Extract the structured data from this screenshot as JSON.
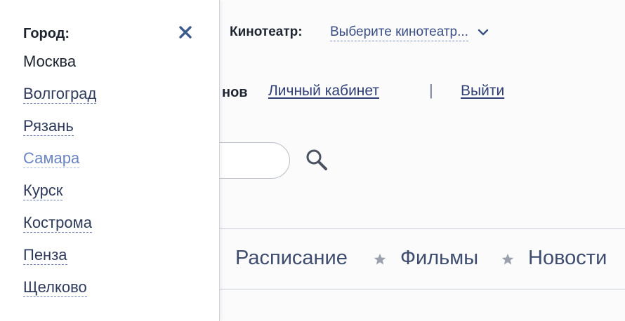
{
  "header": {
    "cinema_label": "Кинотеатр:",
    "cinema_select": "Выберите кинотеатр...",
    "user_fragment": "нов",
    "account_link": "Личный кабинет",
    "separator": "|",
    "logout_link": "Выйти"
  },
  "nav": {
    "items": [
      {
        "label": "Расписание"
      },
      {
        "label": "Фильмы"
      },
      {
        "label": "Новости"
      }
    ]
  },
  "city_panel": {
    "title": "Город:",
    "current": "Москва",
    "cities": [
      {
        "label": "Москва",
        "state": "current"
      },
      {
        "label": "Волгоград",
        "state": "link"
      },
      {
        "label": "Рязань",
        "state": "link"
      },
      {
        "label": "Самара",
        "state": "hover"
      },
      {
        "label": "Курск",
        "state": "link"
      },
      {
        "label": "Кострома",
        "state": "link"
      },
      {
        "label": "Пенза",
        "state": "link"
      },
      {
        "label": "Щелково",
        "state": "link"
      }
    ]
  },
  "colors": {
    "link": "#2f3f75",
    "link_hover": "#6b84c4",
    "nav_text": "#3e4c6e",
    "divider": "#c9ccd3",
    "star": "#9aa1ad"
  },
  "icons": {
    "close": "close-icon",
    "search": "search-icon",
    "dropdown": "chevron-down-icon",
    "nav_separator": "star-icon"
  }
}
